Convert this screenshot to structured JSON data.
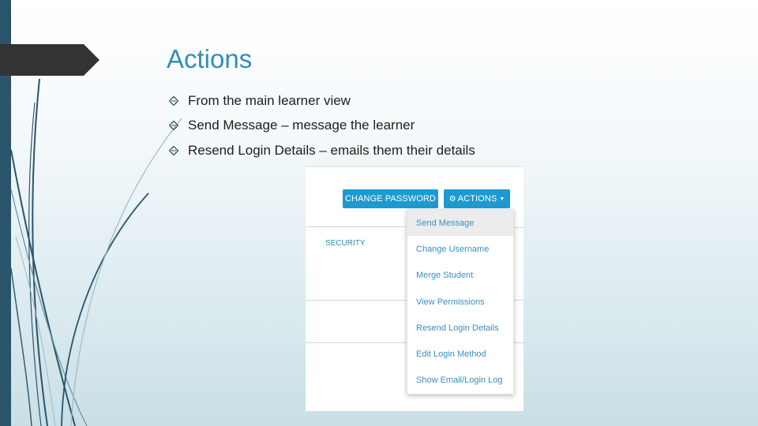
{
  "slide": {
    "title": "Actions",
    "bullets": [
      "From the main learner view",
      "Send Message – message the learner",
      "Resend Login Details – emails them their details"
    ]
  },
  "screenshot": {
    "buttons": {
      "change_password": "CHANGE PASSWORD",
      "actions": "ACTIONS"
    },
    "section_label": "SECURITY",
    "dropdown_items": [
      "Send Message",
      "Change Username",
      "Merge Student",
      "View Permissions",
      "Resend Login Details",
      "Edit Login Method",
      "Show Email/Login Log"
    ],
    "highlighted_item": "Send Message"
  },
  "colors": {
    "accent": "#1d9bd1",
    "title": "#2f8fb6",
    "sidebar": "#2a546a"
  }
}
